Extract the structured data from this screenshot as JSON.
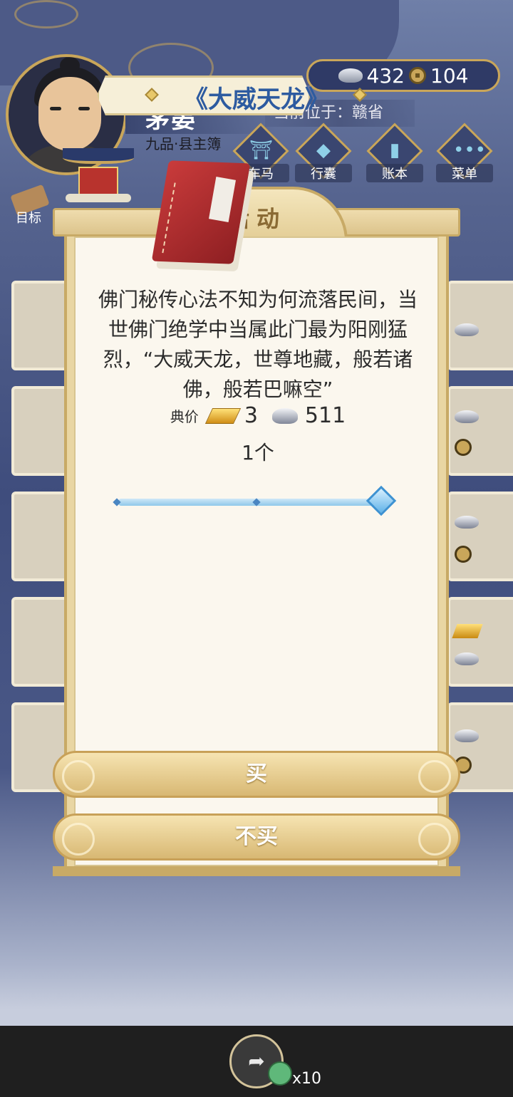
{
  "header": {
    "player_name": "茅晏",
    "player_rank": "九品·县主簿",
    "currency": {
      "silver": "432",
      "copper": "104"
    },
    "location_text": "当前位于：赣省",
    "goal_label": "目标",
    "nav": [
      {
        "label": "车马",
        "icon": "carriage-icon"
      },
      {
        "label": "行囊",
        "icon": "bag-icon"
      },
      {
        "label": "账本",
        "icon": "ledger-icon"
      },
      {
        "label": "菜单",
        "icon": "menu-icon"
      }
    ]
  },
  "modal": {
    "title": "活动",
    "item_name": "《大威天龙》",
    "description": "佛门秘传心法不知为何流落民间，当世佛门绝学中当属此门最为阳刚猛烈，“大威天龙，世尊地藏，般若诸佛，般若巴嘛空”",
    "price_label": "典价",
    "price_gold": "3",
    "price_silver": "511",
    "quantity": "1个",
    "quantity_slider_fraction": 1.0,
    "buy_label": "买",
    "decline_label": "不买"
  },
  "bottom_bar": {
    "share_icon": "share-icon",
    "multiplier": "x10"
  },
  "colors": {
    "accent_gold": "#c8aa66",
    "item_name_blue": "#2d5ba0",
    "slider_blue": "#5fb2e8"
  }
}
